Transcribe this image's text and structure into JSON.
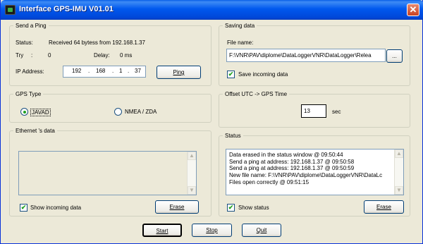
{
  "window": {
    "title": "Interface GPS-IMU V01.01",
    "close_glyph": "✕"
  },
  "ping": {
    "legend": "Send a Ping",
    "status_label": "Status:",
    "status_value": "Received 64 bytess from 192.168.1.37",
    "try_label": "Try",
    "try_sep": ":",
    "try_value": "0",
    "delay_label": "Delay:",
    "delay_value": "0 ms",
    "ip_label": "IP Address:",
    "ip": [
      "192",
      "168",
      "1",
      "37"
    ],
    "ip_dot": ".",
    "ping_button": "Ping"
  },
  "gps_type": {
    "legend": "GPS Type",
    "options": [
      {
        "label": "JAVAD",
        "selected": true
      },
      {
        "label": "NMEA / ZDA",
        "selected": false
      }
    ]
  },
  "ethernet": {
    "legend": "Ethernet 's data",
    "show_label": "Show incoming data",
    "show_checked": true,
    "erase_button": "Erase"
  },
  "saving": {
    "legend": "Saving data",
    "file_label": "File name:",
    "file_value": "F:\\VNR\\PAV\\diplome\\DataLoggerVNR\\DataLogger\\Relea",
    "browse_button": "...",
    "save_label": "Save incoming data",
    "save_checked": true
  },
  "offset": {
    "legend": "Offset UTC -> GPS Time",
    "value": "13",
    "unit": "sec"
  },
  "status": {
    "legend": "Status",
    "lines": [
      "Data erased in the status window   @ 09:50:44",
      "Send a ping at address: 192.168.1.37   @ 09:50:58",
      "Send a ping at address: 192.168.1.37   @ 09:50:59",
      "New file name: F:\\VNR\\PAV\\diplome\\DataLoggerVNR\\DataLc",
      "Files open correctly   @ 09:51:15"
    ],
    "show_label": "Show status",
    "show_checked": true,
    "erase_button": "Erase"
  },
  "footer": {
    "start_button": "Start",
    "stop_button": "Stop",
    "quit_button": "Quit"
  },
  "icons": {
    "scroll_up": "▲",
    "scroll_down": "▼",
    "check": "✔"
  }
}
